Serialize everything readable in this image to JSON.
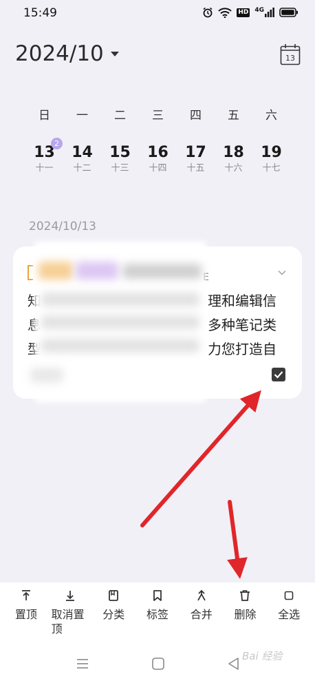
{
  "status_bar": {
    "time": "15:49",
    "icons": [
      "alarm-icon",
      "wifi-icon",
      "hd-icon",
      "4g-signal-icon",
      "battery-icon"
    ],
    "hd_label": "HD",
    "network_label": "4G"
  },
  "calendar": {
    "month_title": "2024/10",
    "calendar_icon_day": "13",
    "weekdays": [
      "日",
      "一",
      "二",
      "三",
      "四",
      "五",
      "六"
    ],
    "days": [
      {
        "num": "13",
        "lunar": "十一",
        "badge": "2"
      },
      {
        "num": "14",
        "lunar": "十二"
      },
      {
        "num": "15",
        "lunar": "十三"
      },
      {
        "num": "16",
        "lunar": "十四"
      },
      {
        "num": "17",
        "lunar": "十五"
      },
      {
        "num": "18",
        "lunar": "十六"
      },
      {
        "num": "19",
        "lunar": "十七"
      }
    ]
  },
  "section": {
    "date": "2024/10/13"
  },
  "note": {
    "line1_start": "知",
    "line1_end": "理和编辑信",
    "line2_start": "息",
    "line2_end": "多种笔记类",
    "line3_start": "型",
    "line3_end": "力您打造自",
    "dash": "E",
    "checked": true
  },
  "toolbar": {
    "items": [
      {
        "label": "置顶",
        "icon": "pin-top-icon"
      },
      {
        "label": "取消置顶",
        "icon": "unpin-icon"
      },
      {
        "label": "分类",
        "icon": "book-icon"
      },
      {
        "label": "标签",
        "icon": "bookmark-icon"
      },
      {
        "label": "合并",
        "icon": "merge-icon"
      },
      {
        "label": "删除",
        "icon": "trash-icon"
      },
      {
        "label": "全选",
        "icon": "select-all-icon"
      }
    ]
  },
  "watermark": "Bai 经验",
  "colors": {
    "background": "#f1f0f6",
    "accent_badge": "#b8a6ee",
    "arrow": "#e0262a",
    "bracket": "#e9a43b"
  }
}
